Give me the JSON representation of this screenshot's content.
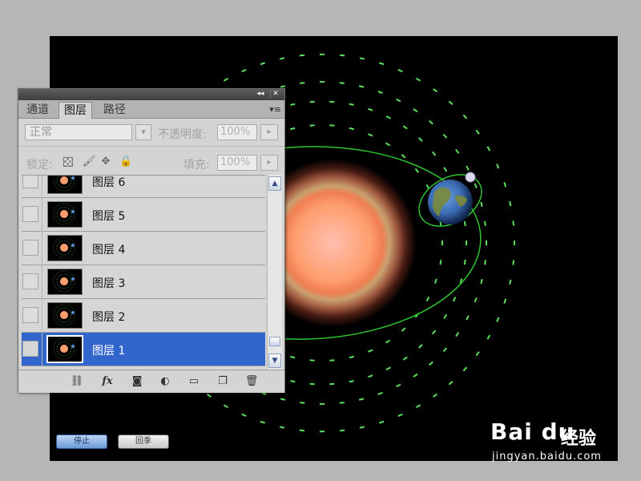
{
  "panel": {
    "tabs": [
      {
        "label": "通道"
      },
      {
        "label": "图层"
      },
      {
        "label": "路径"
      }
    ],
    "blend_mode": "正常",
    "opacity_label": "不透明度:",
    "opacity_value": "100%",
    "lock_label": "锁定:",
    "fill_label": "填充:",
    "fill_value": "100%",
    "layers": [
      {
        "name": "图层 6"
      },
      {
        "name": "图层 5"
      },
      {
        "name": "图层 4"
      },
      {
        "name": "图层 3"
      },
      {
        "name": "图层 2"
      },
      {
        "name": "图层 1"
      }
    ],
    "selected_layer": "图层 1"
  },
  "buttons": {
    "stop_label": "停止",
    "play_label": "回季"
  },
  "watermark": {
    "brand": "Bai  du",
    "product": "经验",
    "url": "jingyan.baidu.com"
  },
  "colors": {
    "selection": "#3366cc",
    "orbit_green": "#33dd33",
    "sun_core": "#ffb080"
  }
}
